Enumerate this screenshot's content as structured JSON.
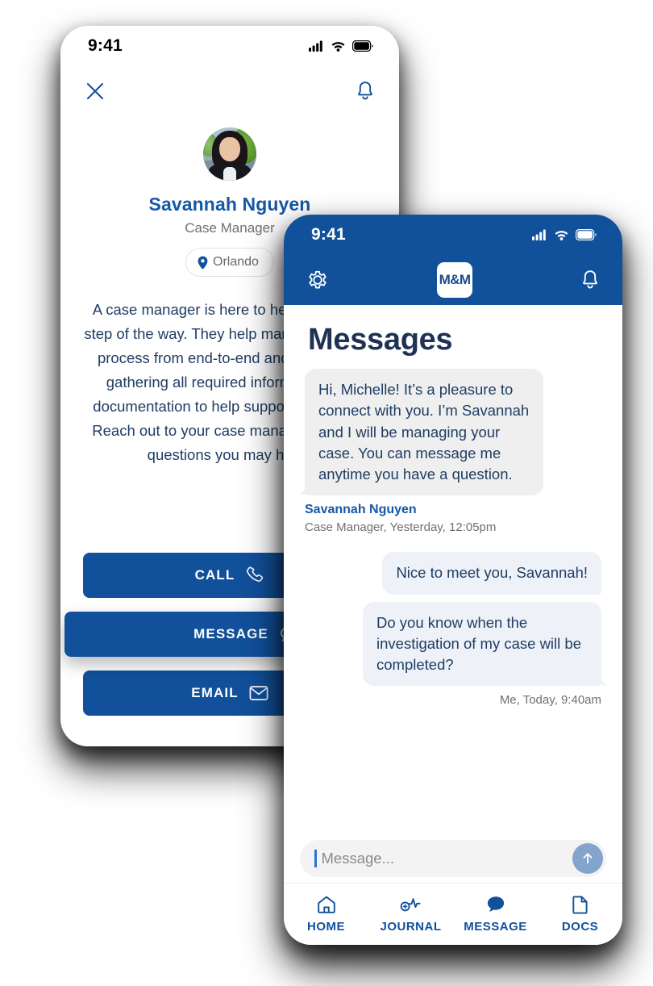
{
  "colors": {
    "brand_blue": "#11509B",
    "name_blue": "#1658A6",
    "text_navy": "#1F3D63",
    "bubble_in": "#EFEFEF",
    "bubble_out": "#EEF2F8",
    "send_button": "#83A4CD"
  },
  "profile_screen": {
    "status_bar": {
      "time": "9:41",
      "signal_icon": "cellular-signal-icon",
      "wifi_icon": "wifi-icon",
      "battery_icon": "battery-icon"
    },
    "top_bar": {
      "close_icon": "close-icon",
      "notifications_icon": "bell-icon"
    },
    "avatar_alt": "avatar",
    "name": "Savannah Nguyen",
    "role": "Case Manager",
    "location": "Orlando",
    "location_icon": "map-pin-icon",
    "description": "A case manager is here to help you every step of the way. They help manage the case process from end-to-end and assist with gathering all required information and documentation to help support your case. Reach out to your case manager with any questions you may have.",
    "actions": [
      {
        "label": "CALL",
        "icon": "phone-icon"
      },
      {
        "label": "MESSAGE",
        "icon": "chat-bubble-icon"
      },
      {
        "label": "EMAIL",
        "icon": "envelope-icon"
      }
    ]
  },
  "messages_screen": {
    "status_bar": {
      "time": "9:41",
      "signal_icon": "cellular-signal-icon",
      "wifi_icon": "wifi-icon",
      "battery_icon": "battery-icon"
    },
    "nav_bar": {
      "settings_icon": "gear-icon",
      "logo_text": "M&M",
      "notifications_icon": "bell-icon"
    },
    "title": "Messages",
    "thread": [
      {
        "direction": "incoming",
        "text": "Hi, Michelle! It’s a pleasure to connect with you. I’m Savannah and I will be managing your case. You can message me anytime you have a question.",
        "sender": "Savannah Nguyen",
        "meta": "Case Manager, Yesterday, 12:05pm"
      },
      {
        "direction": "outgoing",
        "text": "Nice to meet you, Savannah!"
      },
      {
        "direction": "outgoing",
        "text": "Do you know when the investigation of my case will be completed?",
        "meta": "Me, Today, 9:40am"
      }
    ],
    "composer": {
      "placeholder": "Message...",
      "value": "",
      "send_icon": "arrow-up-icon"
    },
    "tabs": [
      {
        "label": "HOME",
        "icon": "home-icon",
        "active": false
      },
      {
        "label": "JOURNAL",
        "icon": "pulse-icon",
        "active": false
      },
      {
        "label": "MESSAGE",
        "icon": "chat-bubble-filled-icon",
        "active": true
      },
      {
        "label": "DOCS",
        "icon": "document-icon",
        "active": false
      }
    ]
  }
}
